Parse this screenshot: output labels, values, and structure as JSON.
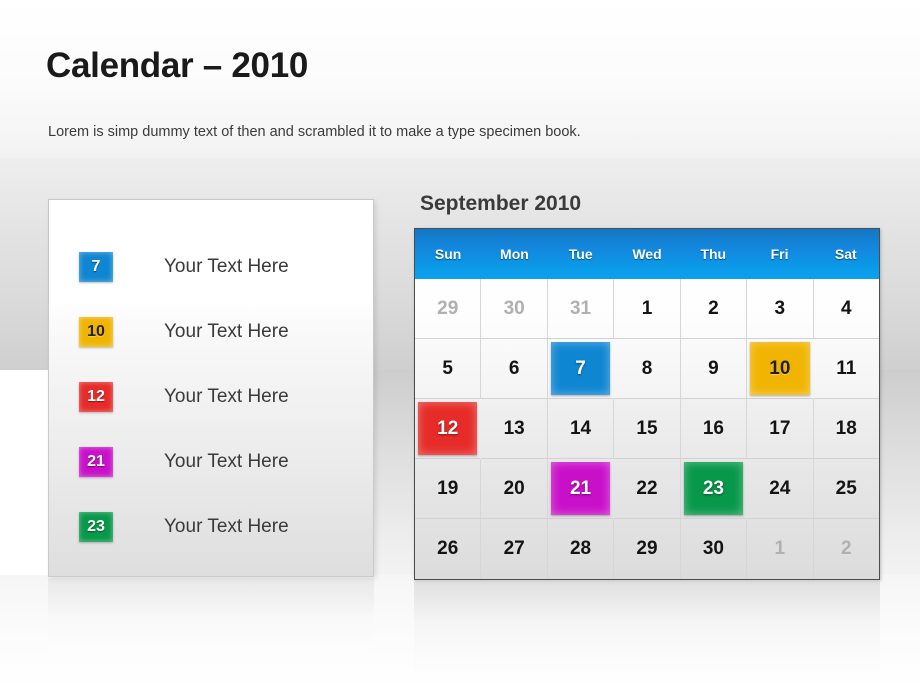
{
  "header": {
    "title": "Calendar – 2010",
    "subtitle": "Lorem is simp dummy text of then and scrambled it to make a type specimen book."
  },
  "legend": {
    "items": [
      {
        "day": "7",
        "label": "Your Text Here",
        "color": "#0f86d2",
        "text_color": "light"
      },
      {
        "day": "10",
        "label": "Your Text Here",
        "color": "#f0b400",
        "text_color": "dark"
      },
      {
        "day": "12",
        "label": "Your Text Here",
        "color": "#e62b28",
        "text_color": "light"
      },
      {
        "day": "21",
        "label": "Your Text Here",
        "color": "#c910c9",
        "text_color": "light"
      },
      {
        "day": "23",
        "label": "Your Text Here",
        "color": "#07984a",
        "text_color": "light"
      }
    ]
  },
  "calendar": {
    "title": "September 2010",
    "weekday_headers": [
      "Sun",
      "Mon",
      "Tue",
      "Wed",
      "Thu",
      "Fri",
      "Sat"
    ],
    "header_color": "#0b8fdf",
    "weeks": [
      [
        {
          "n": "29",
          "muted": true
        },
        {
          "n": "30",
          "muted": true
        },
        {
          "n": "31",
          "muted": true
        },
        {
          "n": "1"
        },
        {
          "n": "2"
        },
        {
          "n": "3"
        },
        {
          "n": "4"
        }
      ],
      [
        {
          "n": "5"
        },
        {
          "n": "6"
        },
        {
          "n": "7",
          "highlight": "#0f86d2",
          "chip_text": "light"
        },
        {
          "n": "8"
        },
        {
          "n": "9"
        },
        {
          "n": "10",
          "highlight": "#f0b400",
          "chip_text": "dark"
        },
        {
          "n": "11"
        }
      ],
      [
        {
          "n": "12",
          "highlight": "#e62b28",
          "chip_text": "light"
        },
        {
          "n": "13"
        },
        {
          "n": "14"
        },
        {
          "n": "15"
        },
        {
          "n": "16"
        },
        {
          "n": "17"
        },
        {
          "n": "18"
        }
      ],
      [
        {
          "n": "19"
        },
        {
          "n": "20"
        },
        {
          "n": "21",
          "highlight": "#c910c9",
          "chip_text": "light"
        },
        {
          "n": "22"
        },
        {
          "n": "23",
          "highlight": "#07984a",
          "chip_text": "light"
        },
        {
          "n": "24"
        },
        {
          "n": "25"
        }
      ],
      [
        {
          "n": "26"
        },
        {
          "n": "27"
        },
        {
          "n": "28"
        },
        {
          "n": "29"
        },
        {
          "n": "30"
        },
        {
          "n": "1",
          "muted": true
        },
        {
          "n": "2",
          "muted": true
        }
      ]
    ]
  }
}
